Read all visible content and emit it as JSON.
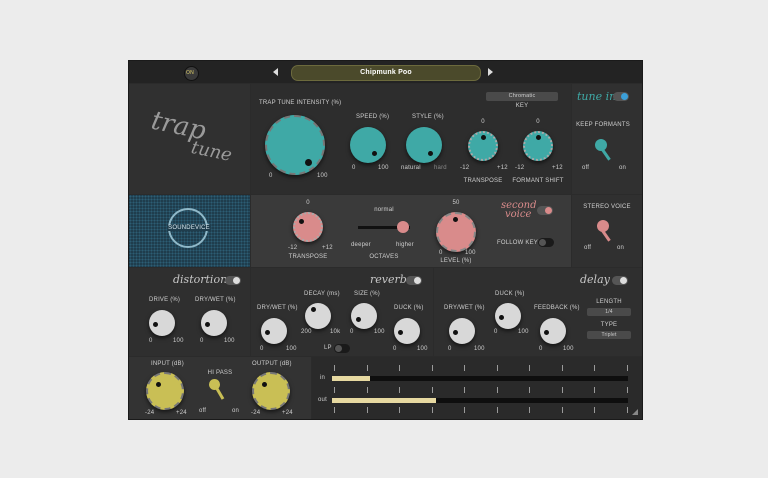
{
  "header": {
    "on_label": "ON",
    "preset_name": "Chipmunk Poo",
    "prev_icon": "triangle-left",
    "next_icon": "triangle-right"
  },
  "logo": {
    "line1": "trap",
    "line2": "tune",
    "brand": "SOUNDEVICE"
  },
  "tune": {
    "intensity_label": "TRAP TUNE INTENSITY (%)",
    "intensity_min": "0",
    "intensity_max": "100",
    "speed_label": "SPEED (%)",
    "speed_min": "0",
    "speed_max": "100",
    "style_label": "STYLE (%)",
    "style_min": "natural",
    "style_max": "hard",
    "key_value": "Chromatic",
    "key_label": "KEY",
    "transpose_label": "TRANSPOSE",
    "transpose_top": "0",
    "transpose_min": "-12",
    "transpose_max": "+12",
    "formant_label": "FORMANT SHIFT",
    "formant_top": "0",
    "formant_min": "-12",
    "formant_max": "+12",
    "tune_in_title": "tune in",
    "keep_formants_label": "KEEP FORMANTS",
    "off": "off",
    "on": "on"
  },
  "second_voice": {
    "title_line1": "second",
    "title_line2": "voice",
    "transpose_label": "TRANSPOSE",
    "transpose_top": "0",
    "transpose_min": "-12",
    "transpose_max": "+12",
    "octaves_label": "OCTAVES",
    "normal": "normal",
    "deeper": "deeper",
    "higher": "higher",
    "level_label": "LEVEL (%)",
    "level_top": "50",
    "level_min": "0",
    "level_max": "100",
    "follow_key_label": "FOLLOW KEY",
    "stereo_label": "STEREO VOICE",
    "off": "off",
    "on": "on"
  },
  "distortion": {
    "title": "distortion",
    "drive_label": "DRIVE (%)",
    "drywet_label": "DRY/WET (%)",
    "min": "0",
    "max": "100"
  },
  "reverb": {
    "title": "reverb",
    "drywet_label": "DRY/WET (%)",
    "decay_label": "DECAY (ms)",
    "decay_min": "200",
    "decay_max": "10k",
    "size_label": "SIZE (%)",
    "duck_label": "DUCK (%)",
    "lp_label": "LP",
    "min": "0",
    "max": "100"
  },
  "delay": {
    "title": "delay",
    "drywet_label": "DRY/WET (%)",
    "duck_label": "DUCK (%)",
    "feedback_label": "FEEDBACK (%)",
    "length_label": "LENGTH",
    "length_value": "1/4",
    "type_label": "TYPE",
    "type_value": "Triplet",
    "min": "0",
    "max": "100"
  },
  "io": {
    "input_label": "INPUT (dB)",
    "input_min": "-24",
    "input_max": "+24",
    "hipass_label": "HI PASS",
    "off": "off",
    "on": "on",
    "output_label": "OUTPUT (dB)",
    "output_min": "-24",
    "output_max": "+24",
    "in_label": "in",
    "out_label": "out",
    "in_level": 0.13,
    "out_level": 0.35
  },
  "colors": {
    "teal": "#3fa9a6",
    "pink": "#d98b8b",
    "yellow": "#c9bf55",
    "cream": "#e7d9a1",
    "white_knob": "#d8d8d8",
    "blue_accent": "#3b9fd8"
  }
}
